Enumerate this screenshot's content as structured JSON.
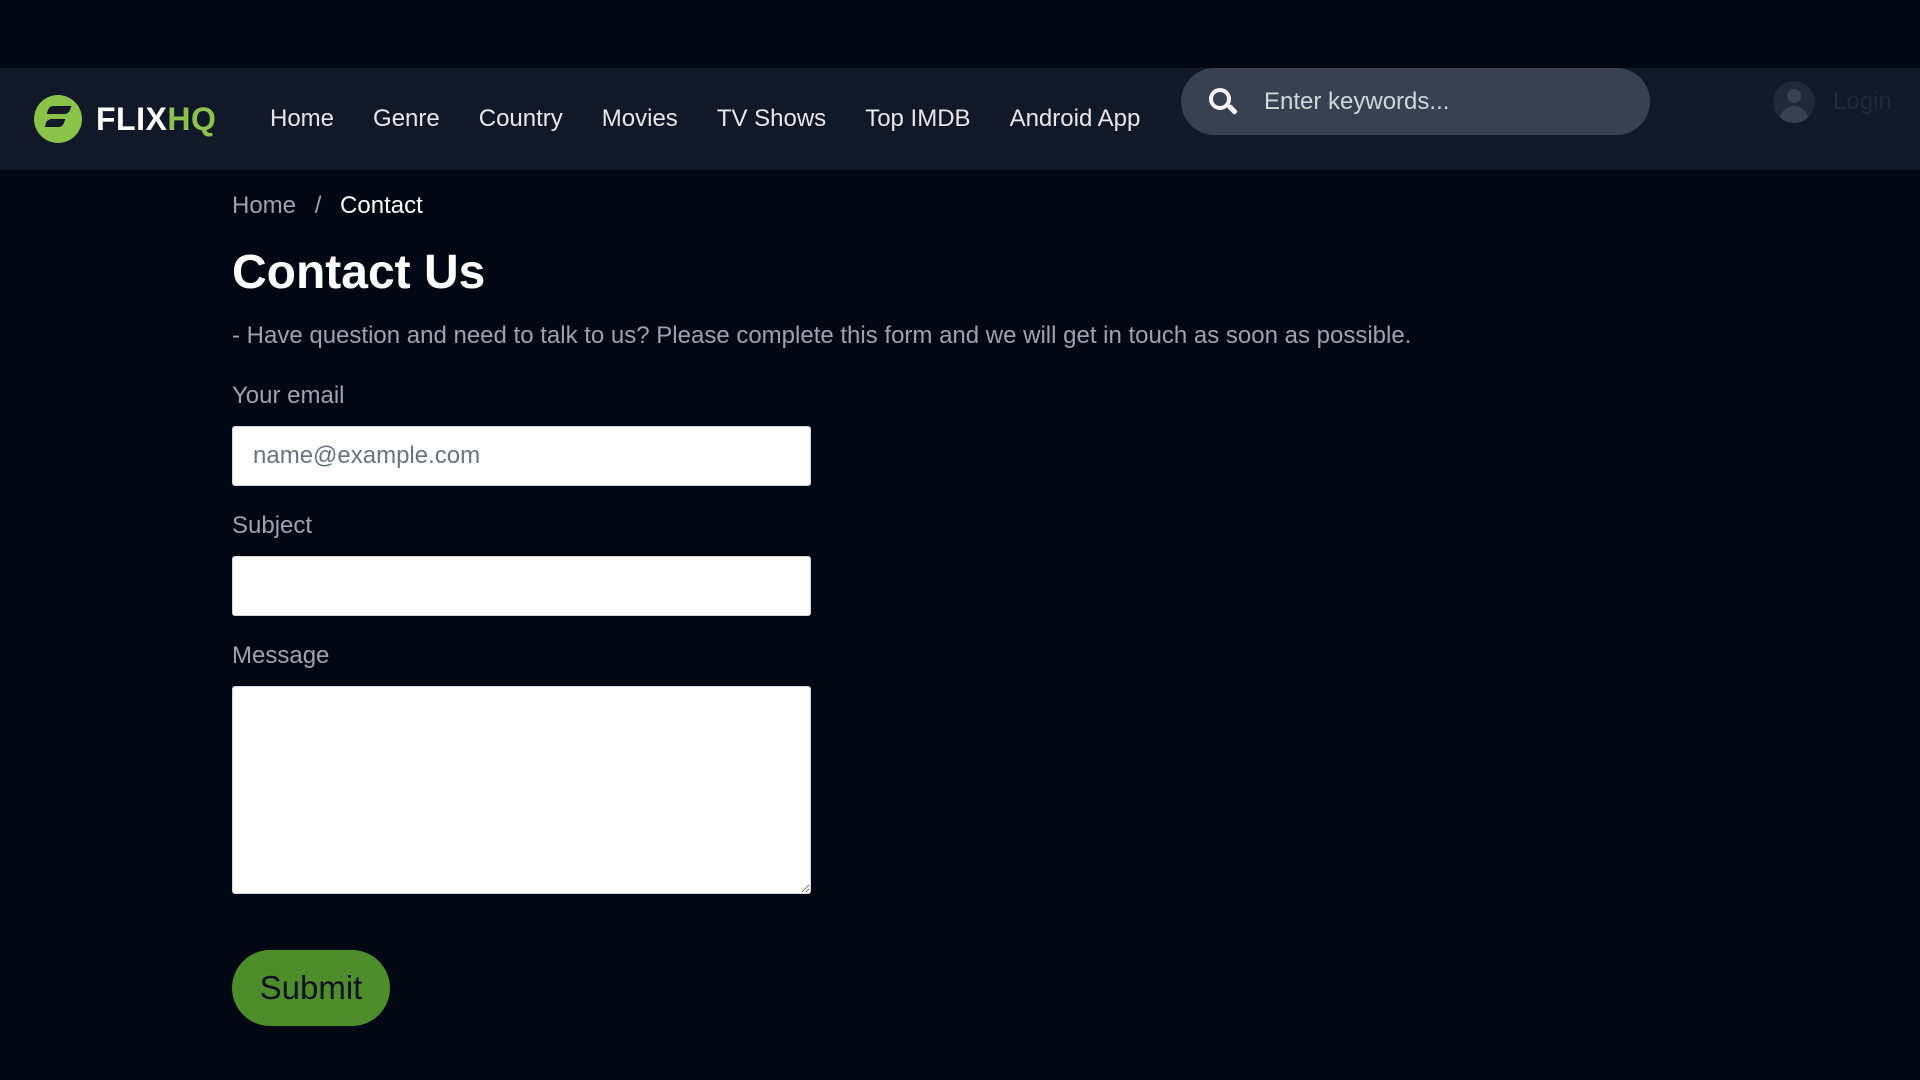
{
  "brand": {
    "name_part1": "FLIX",
    "name_part2": "HQ"
  },
  "nav": {
    "items": [
      {
        "label": "Home"
      },
      {
        "label": "Genre"
      },
      {
        "label": "Country"
      },
      {
        "label": "Movies"
      },
      {
        "label": "TV Shows"
      },
      {
        "label": "Top IMDB"
      },
      {
        "label": "Android App"
      }
    ]
  },
  "search": {
    "placeholder": "Enter keywords...",
    "value": ""
  },
  "account": {
    "login_label": "Login"
  },
  "breadcrumb": {
    "home": "Home",
    "separator": "/",
    "current": "Contact"
  },
  "page": {
    "title": "Contact Us",
    "description": "- Have question and need to talk to us? Please complete this form and we will get in touch as soon as possible."
  },
  "form": {
    "email_label": "Your email",
    "email_placeholder": "name@example.com",
    "email_value": "",
    "subject_label": "Subject",
    "subject_value": "",
    "message_label": "Message",
    "message_value": "",
    "submit_label": "Submit"
  },
  "colors": {
    "background": "#020714",
    "header": "#111827",
    "accent": "#8bc34a",
    "button": "#4d8d2a",
    "muted_text": "#9ca3af"
  }
}
